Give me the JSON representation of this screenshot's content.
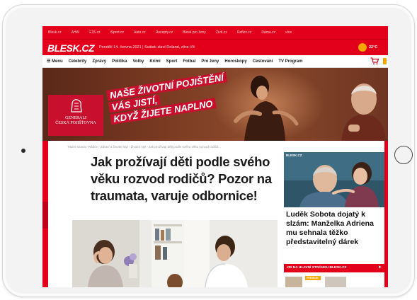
{
  "top_links": [
    "Blesk.cz",
    "AHA!",
    "E15.cz",
    "iSport.cz",
    "Auto.cz",
    "Recepty.cz",
    "Blesk pro ženy",
    "Živě.cz",
    "Reflex.cz",
    "Dáma.cz",
    "více"
  ],
  "brand": {
    "logo": "BLESK.CZ",
    "dateline": "Pondělí 14. června 2021  |  Svátek slaví Roland, zítra Vít",
    "temperature": "22°C"
  },
  "nav": {
    "menu_label": "☰ Menu",
    "items": [
      "Celebrity",
      "Zprávy",
      "Politika",
      "Volby",
      "Krimi",
      "Sport",
      "Fotbal",
      "Pro ženy",
      "Horoskopy",
      "Cestování",
      "TV Program"
    ]
  },
  "ad": {
    "slogan_lines": [
      "NAŠE ŽIVOTNÍ POJIŠTĚNÍ",
      "VÁS JISTÍ,",
      "KDYŽ ŽIJETE NAPLNO"
    ],
    "company": "GENERALI\nČESKÁ POJIŠŤOVNA"
  },
  "article": {
    "breadcrumb": "Titulní strana  ›  Rádce  ›  Zdraví a životní styl  ›  Životní styl  ›  Jak prožívají děti podle svého věku rozvod rodičů...",
    "headline": "Jak prožívají děti podle svého věku rozvod rodičů? Pozor na traumata, varuje odbornice!"
  },
  "sidebar": {
    "tag": "BLESK.CZ",
    "headline": "Luděk Sobota dojatý k slzám: Manželka Adriena mu sehnala těžko představitelný dárek",
    "cta": "JDI NA HLAVNÍ STRÁNKU BLESK.CZ",
    "cta_arrow": "►",
    "premium_tag": "PREMIUM"
  },
  "colors": {
    "brand_red": "#e3001b",
    "generali_red": "#c8102e",
    "accent_orange": "#f6a800"
  }
}
